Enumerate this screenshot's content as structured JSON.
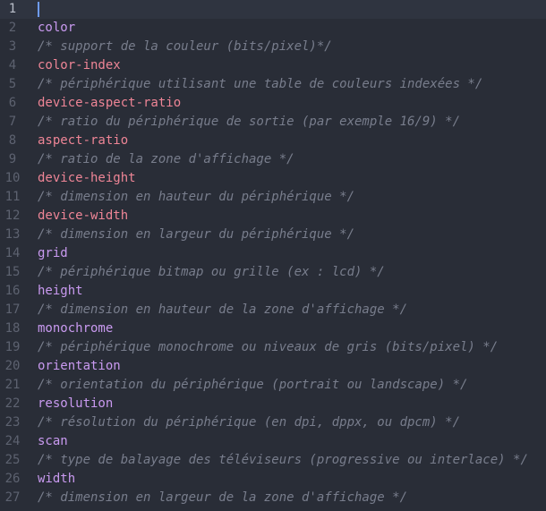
{
  "editor": {
    "colors": {
      "background": "#292d37",
      "active_line": "#2f3440",
      "line_number": "#5d6270",
      "feature_pink": "#ee8596",
      "feature_purple": "#c99af0",
      "comment": "#787d8c",
      "cursor": "#6e9bf5"
    },
    "active_line": 1,
    "lines": [
      {
        "n": "1",
        "text": "",
        "kind": "empty"
      },
      {
        "n": "2",
        "text": "color",
        "kind": "feature-purple"
      },
      {
        "n": "3",
        "text": "/* support de la couleur (bits/pixel)*/",
        "kind": "comment"
      },
      {
        "n": "4",
        "text": "color-index",
        "kind": "feature-pink"
      },
      {
        "n": "5",
        "text": "/* périphérique utilisant une table de couleurs indexées */",
        "kind": "comment"
      },
      {
        "n": "6",
        "text": "device-aspect-ratio",
        "kind": "feature-pink"
      },
      {
        "n": "7",
        "text": "/* ratio du périphérique de sortie (par exemple 16/9) */",
        "kind": "comment"
      },
      {
        "n": "8",
        "text": "aspect-ratio",
        "kind": "feature-pink"
      },
      {
        "n": "9",
        "text": "/* ratio de la zone d'affichage */",
        "kind": "comment"
      },
      {
        "n": "10",
        "text": "device-height",
        "kind": "feature-pink"
      },
      {
        "n": "11",
        "text": "/* dimension en hauteur du périphérique */",
        "kind": "comment"
      },
      {
        "n": "12",
        "text": "device-width",
        "kind": "feature-pink"
      },
      {
        "n": "13",
        "text": "/* dimension en largeur du périphérique */",
        "kind": "comment"
      },
      {
        "n": "14",
        "text": "grid",
        "kind": "feature-purple"
      },
      {
        "n": "15",
        "text": "/* périphérique bitmap ou grille (ex : lcd) */",
        "kind": "comment"
      },
      {
        "n": "16",
        "text": "height",
        "kind": "feature-purple"
      },
      {
        "n": "17",
        "text": "/* dimension en hauteur de la zone d'affichage */",
        "kind": "comment"
      },
      {
        "n": "18",
        "text": "monochrome",
        "kind": "feature-purple"
      },
      {
        "n": "19",
        "text": "/* périphérique monochrome ou niveaux de gris (bits/pixel) */",
        "kind": "comment"
      },
      {
        "n": "20",
        "text": "orientation",
        "kind": "feature-purple"
      },
      {
        "n": "21",
        "text": "/* orientation du périphérique (portrait ou landscape) */",
        "kind": "comment"
      },
      {
        "n": "22",
        "text": "resolution",
        "kind": "feature-purple"
      },
      {
        "n": "23",
        "text": "/* résolution du périphérique (en dpi, dppx, ou dpcm) */",
        "kind": "comment"
      },
      {
        "n": "24",
        "text": "scan",
        "kind": "feature-purple"
      },
      {
        "n": "25",
        "text": "/* type de balayage des téléviseurs (progressive ou interlace) */",
        "kind": "comment"
      },
      {
        "n": "26",
        "text": "width",
        "kind": "feature-purple"
      },
      {
        "n": "27",
        "text": "/* dimension en largeur de la zone d'affichage */",
        "kind": "comment"
      }
    ]
  }
}
